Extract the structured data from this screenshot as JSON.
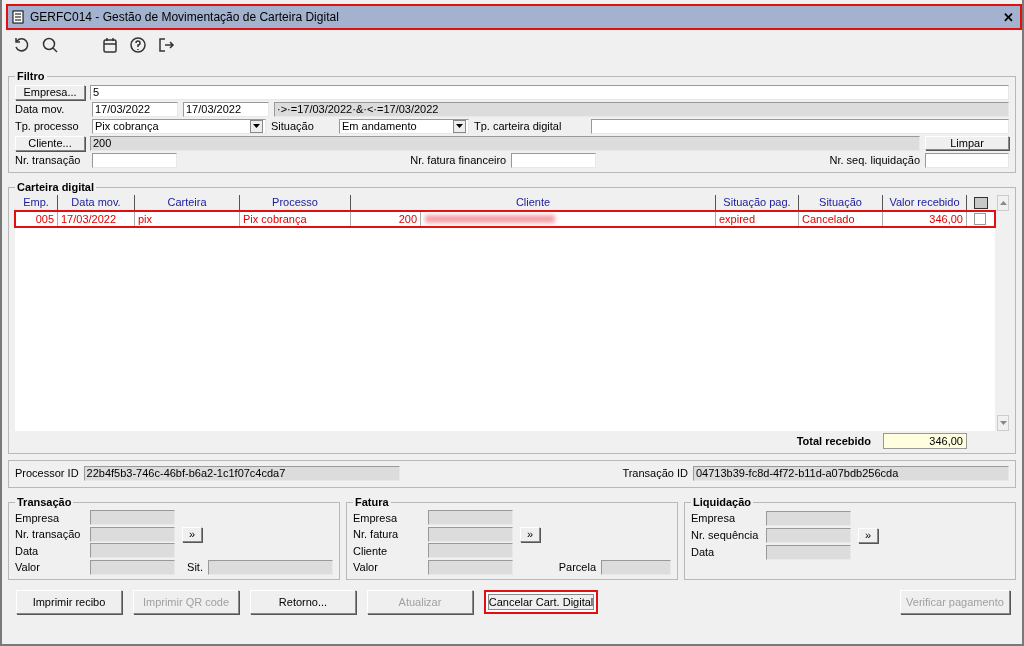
{
  "window": {
    "title": "GERFC014 - Gestão de Movimentação de Carteira Digital",
    "highlighted": true,
    "close": "✕"
  },
  "toolbar": [
    {
      "kind": "undo"
    },
    {
      "kind": "search"
    },
    {
      "kind": "calendar"
    },
    {
      "kind": "help"
    },
    {
      "kind": "exit"
    }
  ],
  "filter": {
    "title": "Filtro",
    "empresa_button": "Empresa...",
    "empresa": "5",
    "data_mov_label": "Data mov.",
    "date_from": "17/03/2022",
    "date_to": "17/03/2022",
    "date_expression": "·>·=17/03/2022·&·<·=17/03/2022",
    "tp_processo_label": "Tp. processo",
    "tp_processo": "Pix cobrança",
    "situacao_label": "Situação",
    "situacao": "Em andamento",
    "tp_carteira_label": "Tp. carteira digital",
    "cliente_button": "Cliente...",
    "cliente": "200",
    "limpar_button": "Limpar",
    "nr_transacao_label": "Nr. transação",
    "nr_fatura_label": "Nr. fatura financeiro",
    "nr_seq_label": "Nr. seq. liquidação"
  },
  "grid": {
    "title": "Carteira digital",
    "columns": [
      {
        "label": "Emp."
      },
      {
        "label": "Data mov."
      },
      {
        "label": "Carteira"
      },
      {
        "label": "Processo"
      },
      {
        "label": "Cliente"
      },
      {
        "label": "Situação pag."
      },
      {
        "label": "Situação"
      },
      {
        "label": "Valor recebido"
      }
    ],
    "select_all_checked": false,
    "rows": [
      {
        "cells": [
          "005",
          "17/03/2022",
          "pix",
          "Pix cobrança",
          "200",
          "expired",
          "Cancelado",
          "346,00"
        ],
        "client_name_redacted": true,
        "checked": false,
        "highlighted": true
      }
    ],
    "total_label": "Total recebido",
    "total": "346,00"
  },
  "ids": {
    "processor_label": "Processor ID",
    "processor_id": "22b4f5b3-746c-46bf-b6a2-1c1f07c4cda7",
    "transaction_label": "Transação ID",
    "transaction_id": "04713b39-fc8d-4f72-b11d-a07bdb256cda"
  },
  "panels": [
    {
      "title": "Transação",
      "rows": [
        {
          "label": "Empresa"
        },
        {
          "label": "Nr. transação",
          "nav": "»"
        },
        {
          "label": "Data"
        },
        {
          "label": "Valor",
          "side_label": "Sit."
        }
      ]
    },
    {
      "title": "Fatura",
      "rows": [
        {
          "label": "Empresa"
        },
        {
          "label": "Nr. fatura",
          "nav": "»"
        },
        {
          "label": "Cliente"
        },
        {
          "label": "Valor",
          "side_label": "Parcela"
        }
      ]
    },
    {
      "title": "Liquidação",
      "rows": [
        {
          "label": "Empresa"
        },
        {
          "label": "Nr. sequência",
          "nav": "»"
        },
        {
          "label": "Data"
        }
      ]
    }
  ],
  "buttons": [
    {
      "label": "Imprimir recibo",
      "disabled": false,
      "highlighted": false
    },
    {
      "label": "Imprimir QR code",
      "disabled": true,
      "highlighted": false
    },
    {
      "label": "Retorno...",
      "disabled": false,
      "highlighted": false
    },
    {
      "label": "Atualizar",
      "disabled": true,
      "highlighted": false
    },
    {
      "label": "Cancelar Cart. Digital",
      "disabled": false,
      "highlighted": true
    }
  ],
  "right_buttons": [
    {
      "label": "Verificar pagamento",
      "disabled": true,
      "highlighted": false
    }
  ]
}
